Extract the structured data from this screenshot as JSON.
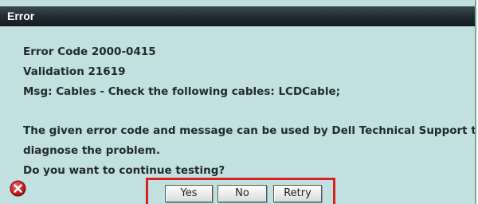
{
  "window": {
    "title": "Error"
  },
  "message": {
    "error_code": "Error Code 2000-0415",
    "validation": "Validation 21619",
    "msg": "Msg: Cables - Check the following cables: LCDCable;",
    "explanation_1": "The given error code and message can be used by Dell Technical Support to help",
    "explanation_2": "diagnose the problem.",
    "question": "Do you want to continue testing?"
  },
  "buttons": {
    "yes": "Yes",
    "no": "No",
    "retry": "Retry"
  },
  "icons": {
    "status": "error-icon"
  },
  "colors": {
    "dialog_bg": "#c2e0e0",
    "title_bg": "#1f2a30",
    "highlight": "#d9201c",
    "error_red": "#d8262b"
  }
}
